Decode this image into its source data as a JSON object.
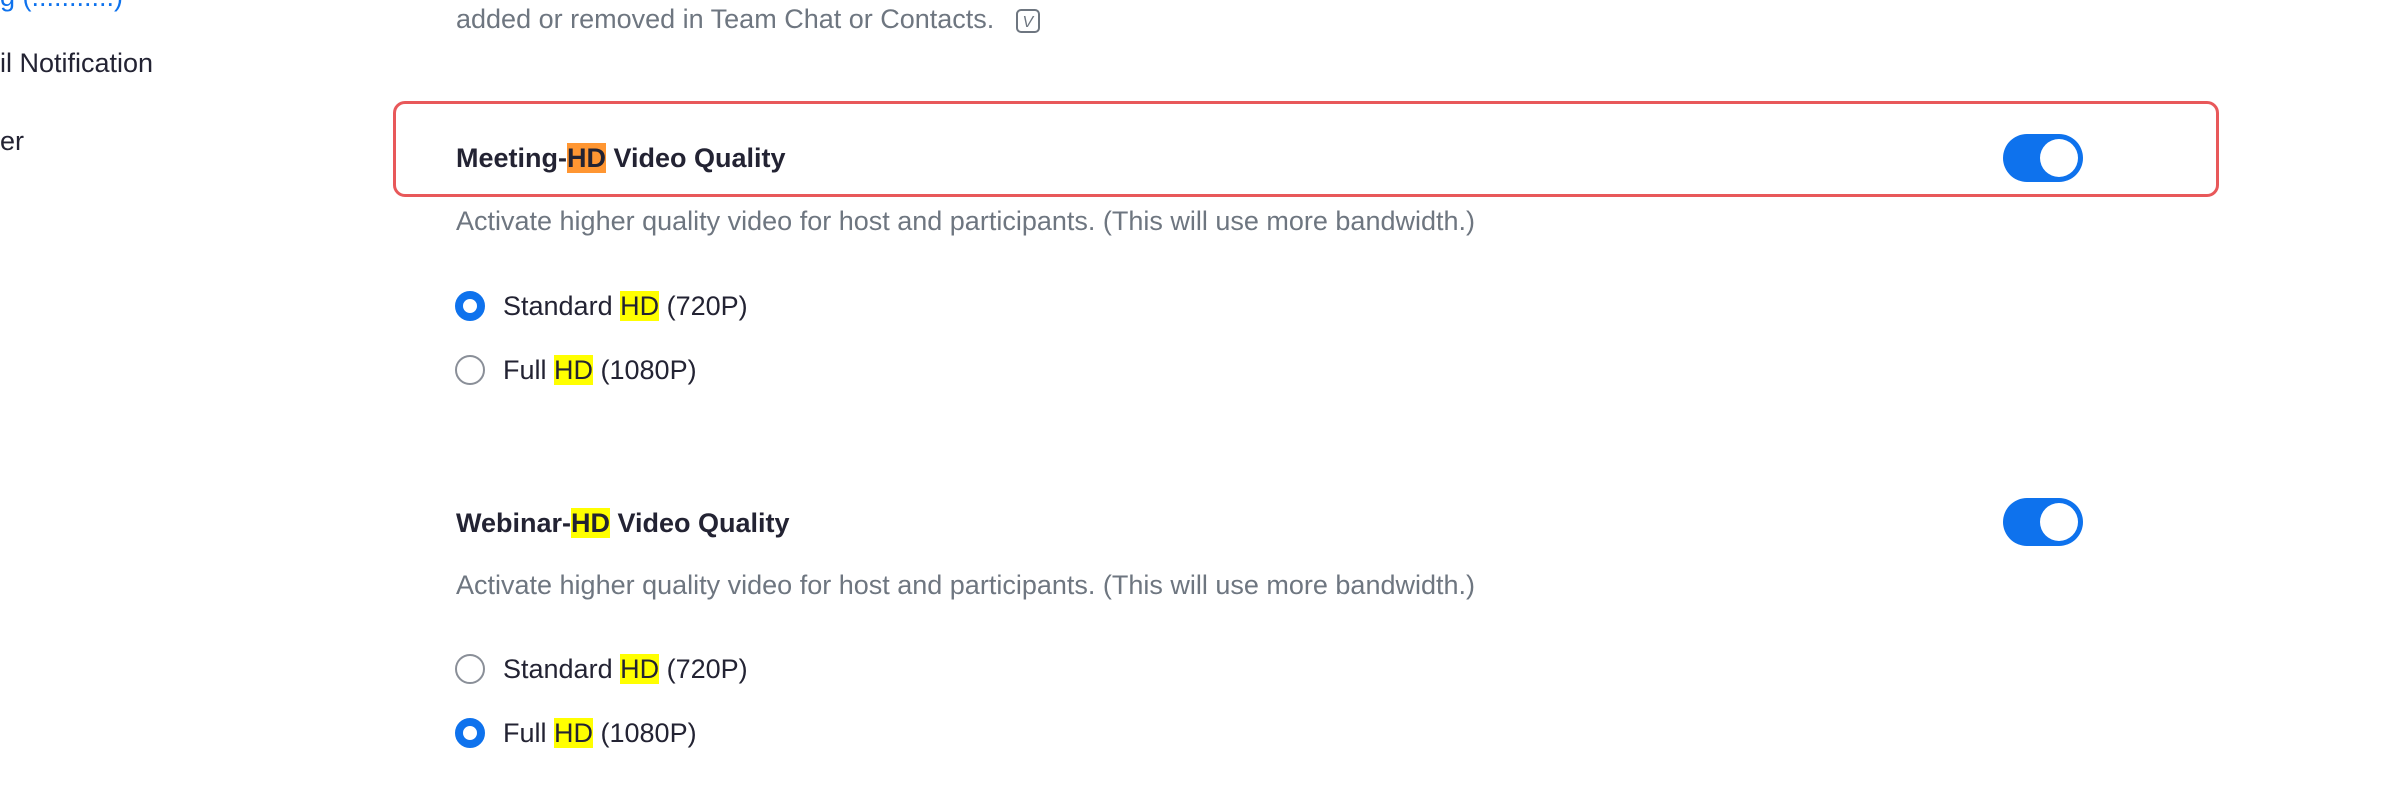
{
  "sidebar": {
    "items": [
      {
        "label": "g (...........)"
      },
      {
        "label": "il Notification"
      },
      {
        "label": "er"
      }
    ]
  },
  "top_description": {
    "text": "added or removed in Team Chat or Contacts.",
    "badge": "V"
  },
  "settings": [
    {
      "title_prefix": "Meeting-",
      "title_highlight": "HD",
      "title_suffix": " Video Quality",
      "description": "Activate higher quality video for host and participants. (This will use more bandwidth.)",
      "enabled": true,
      "options": [
        {
          "prefix": "Standard ",
          "highlight": "HD",
          "suffix": " (720P)",
          "checked": true
        },
        {
          "prefix": "Full ",
          "highlight": "HD",
          "suffix": " (1080P)",
          "checked": false
        }
      ]
    },
    {
      "title_prefix": "Webinar-",
      "title_highlight": "HD",
      "title_suffix": " Video Quality",
      "description": "Activate higher quality video for host and participants. (This will use more bandwidth.)",
      "enabled": true,
      "options": [
        {
          "prefix": "Standard ",
          "highlight": "HD",
          "suffix": " (720P)",
          "checked": false
        },
        {
          "prefix": "Full ",
          "highlight": "HD",
          "suffix": " (1080P)",
          "checked": true
        }
      ]
    }
  ],
  "colors": {
    "accent": "#0e72ed",
    "search_highlight": "#ffff00",
    "current_highlight": "#ff9632",
    "focus_border": "#e8585a"
  }
}
